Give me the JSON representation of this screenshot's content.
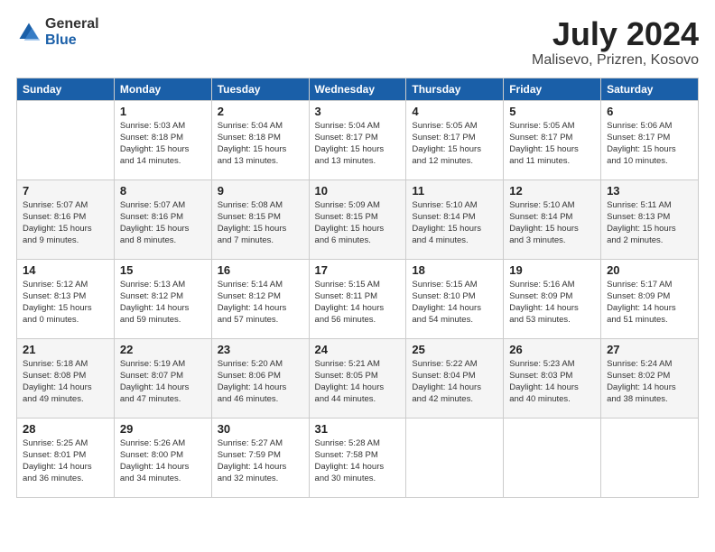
{
  "logo": {
    "general": "General",
    "blue": "Blue"
  },
  "title": "July 2024",
  "subtitle": "Malisevo, Prizren, Kosovo",
  "headers": [
    "Sunday",
    "Monday",
    "Tuesday",
    "Wednesday",
    "Thursday",
    "Friday",
    "Saturday"
  ],
  "weeks": [
    [
      {
        "num": "",
        "info": ""
      },
      {
        "num": "1",
        "info": "Sunrise: 5:03 AM\nSunset: 8:18 PM\nDaylight: 15 hours\nand 14 minutes."
      },
      {
        "num": "2",
        "info": "Sunrise: 5:04 AM\nSunset: 8:18 PM\nDaylight: 15 hours\nand 13 minutes."
      },
      {
        "num": "3",
        "info": "Sunrise: 5:04 AM\nSunset: 8:17 PM\nDaylight: 15 hours\nand 13 minutes."
      },
      {
        "num": "4",
        "info": "Sunrise: 5:05 AM\nSunset: 8:17 PM\nDaylight: 15 hours\nand 12 minutes."
      },
      {
        "num": "5",
        "info": "Sunrise: 5:05 AM\nSunset: 8:17 PM\nDaylight: 15 hours\nand 11 minutes."
      },
      {
        "num": "6",
        "info": "Sunrise: 5:06 AM\nSunset: 8:17 PM\nDaylight: 15 hours\nand 10 minutes."
      }
    ],
    [
      {
        "num": "7",
        "info": "Sunrise: 5:07 AM\nSunset: 8:16 PM\nDaylight: 15 hours\nand 9 minutes."
      },
      {
        "num": "8",
        "info": "Sunrise: 5:07 AM\nSunset: 8:16 PM\nDaylight: 15 hours\nand 8 minutes."
      },
      {
        "num": "9",
        "info": "Sunrise: 5:08 AM\nSunset: 8:15 PM\nDaylight: 15 hours\nand 7 minutes."
      },
      {
        "num": "10",
        "info": "Sunrise: 5:09 AM\nSunset: 8:15 PM\nDaylight: 15 hours\nand 6 minutes."
      },
      {
        "num": "11",
        "info": "Sunrise: 5:10 AM\nSunset: 8:14 PM\nDaylight: 15 hours\nand 4 minutes."
      },
      {
        "num": "12",
        "info": "Sunrise: 5:10 AM\nSunset: 8:14 PM\nDaylight: 15 hours\nand 3 minutes."
      },
      {
        "num": "13",
        "info": "Sunrise: 5:11 AM\nSunset: 8:13 PM\nDaylight: 15 hours\nand 2 minutes."
      }
    ],
    [
      {
        "num": "14",
        "info": "Sunrise: 5:12 AM\nSunset: 8:13 PM\nDaylight: 15 hours\nand 0 minutes."
      },
      {
        "num": "15",
        "info": "Sunrise: 5:13 AM\nSunset: 8:12 PM\nDaylight: 14 hours\nand 59 minutes."
      },
      {
        "num": "16",
        "info": "Sunrise: 5:14 AM\nSunset: 8:12 PM\nDaylight: 14 hours\nand 57 minutes."
      },
      {
        "num": "17",
        "info": "Sunrise: 5:15 AM\nSunset: 8:11 PM\nDaylight: 14 hours\nand 56 minutes."
      },
      {
        "num": "18",
        "info": "Sunrise: 5:15 AM\nSunset: 8:10 PM\nDaylight: 14 hours\nand 54 minutes."
      },
      {
        "num": "19",
        "info": "Sunrise: 5:16 AM\nSunset: 8:09 PM\nDaylight: 14 hours\nand 53 minutes."
      },
      {
        "num": "20",
        "info": "Sunrise: 5:17 AM\nSunset: 8:09 PM\nDaylight: 14 hours\nand 51 minutes."
      }
    ],
    [
      {
        "num": "21",
        "info": "Sunrise: 5:18 AM\nSunset: 8:08 PM\nDaylight: 14 hours\nand 49 minutes."
      },
      {
        "num": "22",
        "info": "Sunrise: 5:19 AM\nSunset: 8:07 PM\nDaylight: 14 hours\nand 47 minutes."
      },
      {
        "num": "23",
        "info": "Sunrise: 5:20 AM\nSunset: 8:06 PM\nDaylight: 14 hours\nand 46 minutes."
      },
      {
        "num": "24",
        "info": "Sunrise: 5:21 AM\nSunset: 8:05 PM\nDaylight: 14 hours\nand 44 minutes."
      },
      {
        "num": "25",
        "info": "Sunrise: 5:22 AM\nSunset: 8:04 PM\nDaylight: 14 hours\nand 42 minutes."
      },
      {
        "num": "26",
        "info": "Sunrise: 5:23 AM\nSunset: 8:03 PM\nDaylight: 14 hours\nand 40 minutes."
      },
      {
        "num": "27",
        "info": "Sunrise: 5:24 AM\nSunset: 8:02 PM\nDaylight: 14 hours\nand 38 minutes."
      }
    ],
    [
      {
        "num": "28",
        "info": "Sunrise: 5:25 AM\nSunset: 8:01 PM\nDaylight: 14 hours\nand 36 minutes."
      },
      {
        "num": "29",
        "info": "Sunrise: 5:26 AM\nSunset: 8:00 PM\nDaylight: 14 hours\nand 34 minutes."
      },
      {
        "num": "30",
        "info": "Sunrise: 5:27 AM\nSunset: 7:59 PM\nDaylight: 14 hours\nand 32 minutes."
      },
      {
        "num": "31",
        "info": "Sunrise: 5:28 AM\nSunset: 7:58 PM\nDaylight: 14 hours\nand 30 minutes."
      },
      {
        "num": "",
        "info": ""
      },
      {
        "num": "",
        "info": ""
      },
      {
        "num": "",
        "info": ""
      }
    ]
  ]
}
